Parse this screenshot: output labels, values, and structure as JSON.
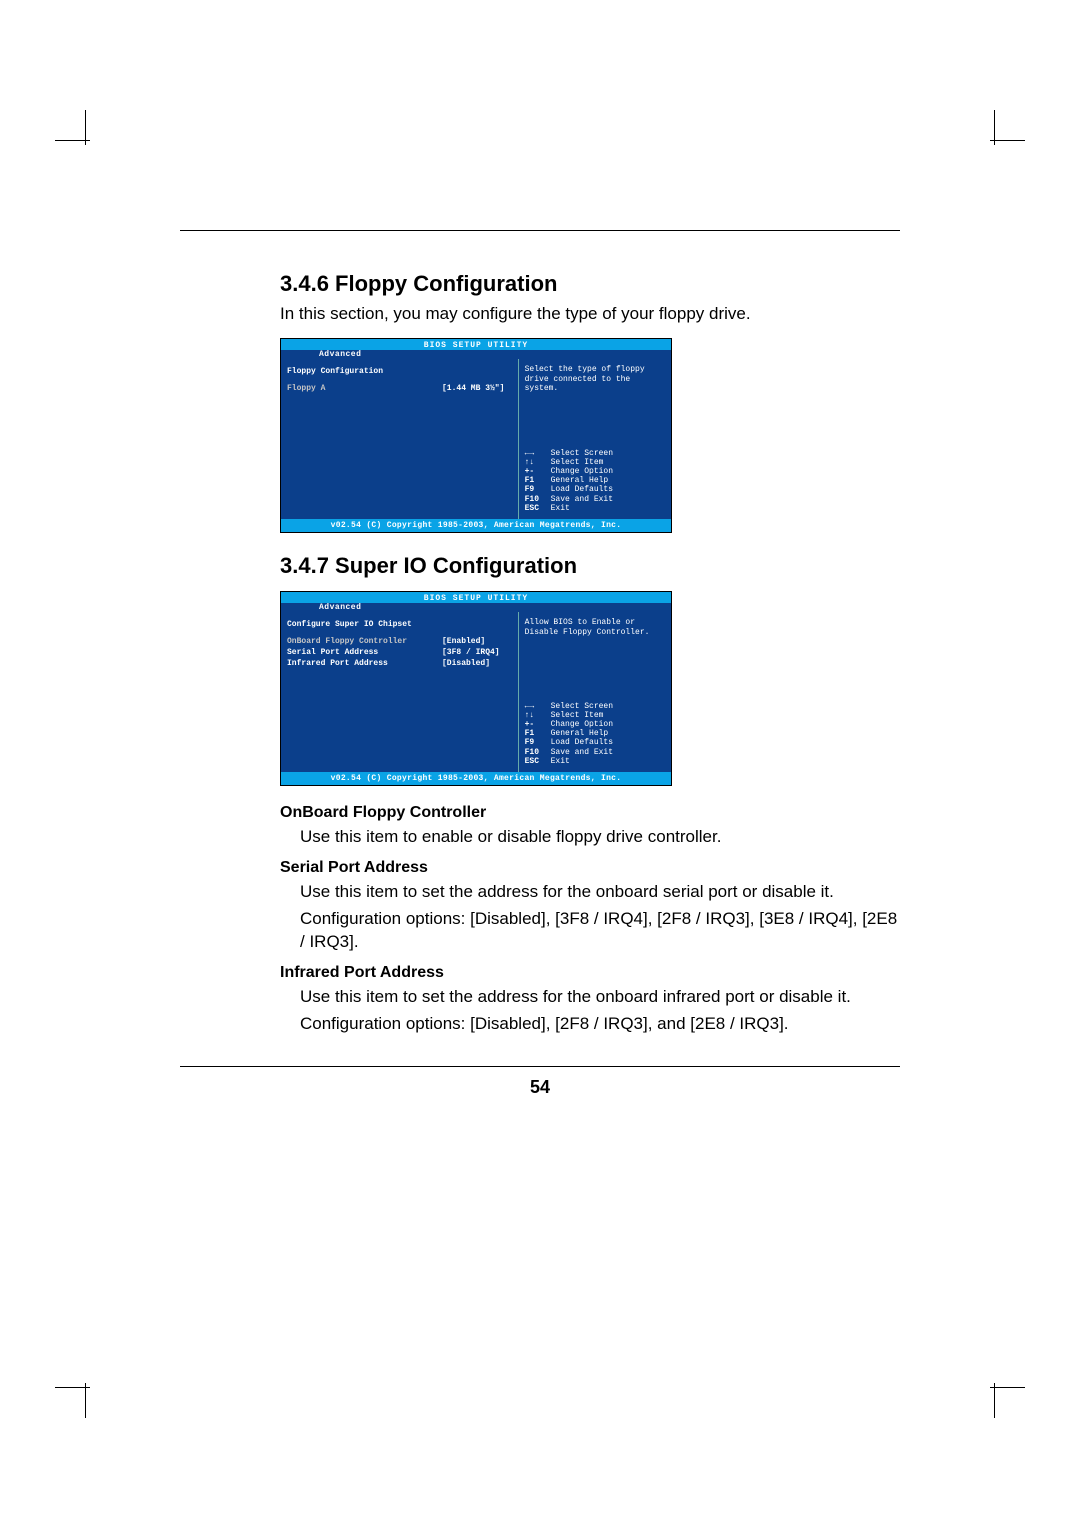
{
  "page_number": "54",
  "section1": {
    "heading": "3.4.6 Floppy Configuration",
    "intro": "In this section, you may configure the type of your floppy drive."
  },
  "section2": {
    "heading": "3.4.7 Super IO Configuration"
  },
  "opts": {
    "onboard_label": "OnBoard Floppy Controller",
    "onboard_desc": "Use this item to enable or disable floppy drive controller.",
    "serial_label": "Serial Port Address",
    "serial_desc1": "Use this item to set the address for the onboard serial port or disable it.",
    "serial_desc2": "Configuration options: [Disabled], [3F8 / IRQ4], [2F8 / IRQ3], [3E8 / IRQ4], [2E8 / IRQ3].",
    "infrared_label": "Infrared Port Address",
    "infrared_desc1": "Use this item to set the address for the onboard infrared port or disable it.",
    "infrared_desc2": "Configuration options: [Disabled], [2F8 / IRQ3], and [2E8 / IRQ3]."
  },
  "bios_common": {
    "title": "BIOS SETUP UTILITY",
    "tab": "Advanced",
    "footer": "v02.54 (C) Copyright 1985-2003, American Megatrends, Inc.",
    "keys": [
      {
        "k": "←→",
        "a": "Select Screen"
      },
      {
        "k": "↑↓",
        "a": "Select Item"
      },
      {
        "k": "+-",
        "a": "Change Option"
      },
      {
        "k": "F1",
        "a": "General Help"
      },
      {
        "k": "F9",
        "a": "Load Defaults"
      },
      {
        "k": "F10",
        "a": "Save and Exit"
      },
      {
        "k": "ESC",
        "a": "Exit"
      }
    ]
  },
  "bios1": {
    "panel_title": "Floppy Configuration",
    "rows": [
      {
        "name": "Floppy A",
        "value": "[1.44 MB  3½\"]",
        "sel": true
      }
    ],
    "help": "Select the type of floppy drive connected to the system."
  },
  "bios2": {
    "panel_title": "Configure Super IO Chipset",
    "rows": [
      {
        "name": "OnBoard Floppy Controller",
        "value": "[Enabled]",
        "sel": true
      },
      {
        "name": "Serial Port Address",
        "value": "[3F8 / IRQ4]",
        "sel": false
      },
      {
        "name": "Infrared Port Address",
        "value": "[Disabled]",
        "sel": false
      }
    ],
    "help": "Allow BIOS to Enable or Disable Floppy Controller."
  }
}
